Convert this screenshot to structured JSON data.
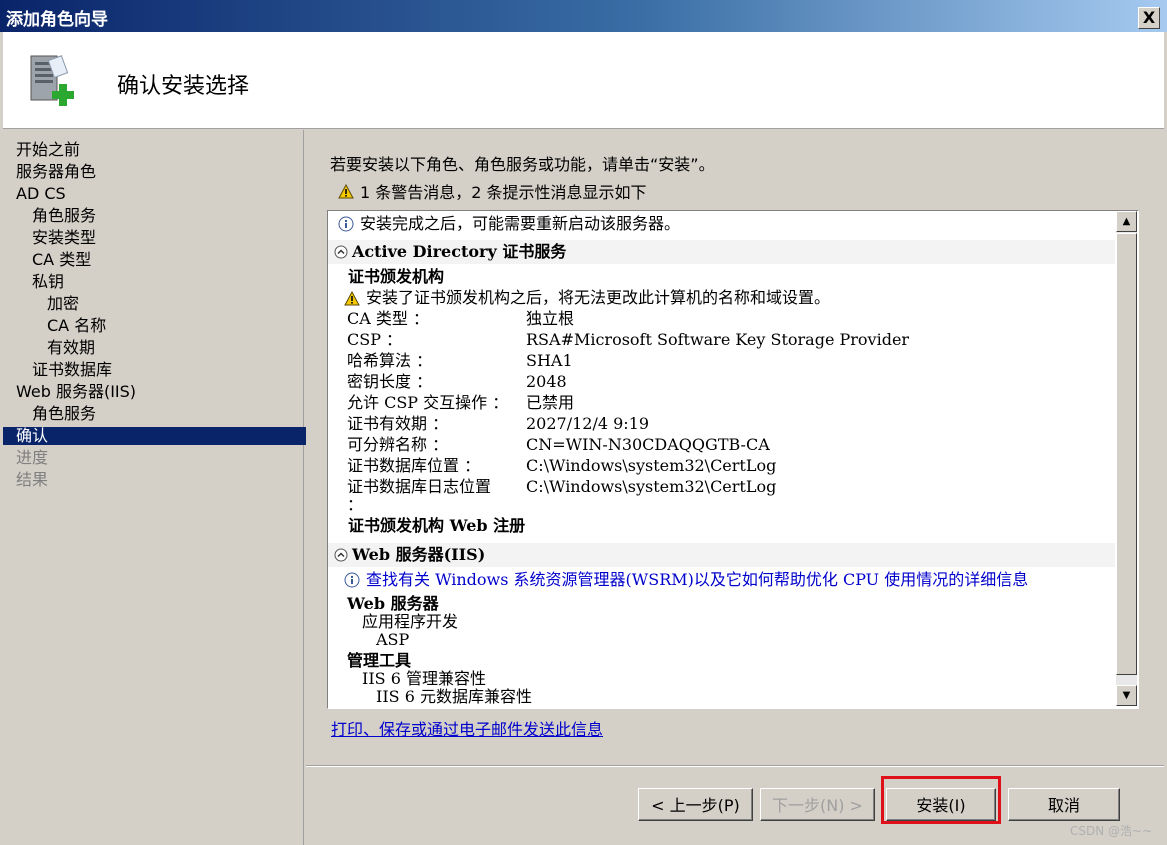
{
  "window": {
    "title": "添加角色向导",
    "close_glyph": "X"
  },
  "header": {
    "title": "确认安装选择",
    "icon": "server-add-icon"
  },
  "nav": {
    "items": [
      {
        "label": "开始之前",
        "state": "normal"
      },
      {
        "label": "服务器角色",
        "state": "normal"
      },
      {
        "label": "AD CS",
        "state": "normal"
      },
      {
        "label": "角色服务",
        "state": "normal"
      },
      {
        "label": "安装类型",
        "state": "normal"
      },
      {
        "label": "CA 类型",
        "state": "normal"
      },
      {
        "label": "私钥",
        "state": "normal"
      },
      {
        "label": "加密",
        "state": "normal"
      },
      {
        "label": "CA 名称",
        "state": "normal"
      },
      {
        "label": "有效期",
        "state": "normal"
      },
      {
        "label": "证书数据库",
        "state": "normal"
      },
      {
        "label": "Web 服务器(IIS)",
        "state": "normal"
      },
      {
        "label": "角色服务",
        "state": "normal"
      },
      {
        "label": "确认",
        "state": "active"
      },
      {
        "label": "进度",
        "state": "disabled"
      },
      {
        "label": "结果",
        "state": "disabled"
      }
    ]
  },
  "main": {
    "instruction": "若要安装以下角色、角色服务或功能，请单击“安装”。",
    "warning_summary": "1 条警告消息，2 条提示性消息显示如下",
    "details": {
      "info_restart": "安装完成之后，可能需要重新启动该服务器。",
      "adcs_section": "Active Directory 证书服务",
      "ca_heading": "证书颁发机构",
      "ca_warning": "安装了证书颁发机构之后，将无法更改此计算机的名称和域设置。",
      "props": [
        {
          "key": "CA 类型 ：",
          "value": "独立根"
        },
        {
          "key": "CSP ：",
          "value": "RSA#Microsoft Software Key Storage Provider"
        },
        {
          "key": "哈希算法 ：",
          "value": "SHA1"
        },
        {
          "key": "密钥长度 ：",
          "value": "2048"
        },
        {
          "key": "允许 CSP 交互操作 ：",
          "value": "已禁用"
        },
        {
          "key": "证书有效期 ：",
          "value": "2027/12/4 9:19"
        },
        {
          "key": "可分辨名称 ：",
          "value": "CN=WIN-N30CDAQQGTB-CA"
        },
        {
          "key": "证书数据库位置 ：",
          "value": "C:\\Windows\\system32\\CertLog"
        },
        {
          "key": "证书数据库日志位置",
          "value": "C:\\Windows\\system32\\CertLog"
        }
      ],
      "colon_wrap": "：",
      "web_enroll": "证书颁发机构 Web 注册",
      "iis_section": "Web 服务器(IIS)",
      "wsrm_link": "查找有关 Windows 系统资源管理器(WSRM)以及它如何帮助优化 CPU 使用情况的详细信息",
      "web_server": "Web 服务器",
      "app_dev": "应用程序开发",
      "asp": "ASP",
      "mgmt_tools": "管理工具",
      "iis6_compat": "IIS 6 管理兼容性",
      "iis6_meta": "IIS 6 元数据库兼容性"
    },
    "print_link": "打印、保存或通过电子邮件发送此信息"
  },
  "buttons": {
    "back": "< 上一步(P)",
    "next": "下一步(N) >",
    "install": "安装(I)",
    "cancel": "取消"
  },
  "watermark": "CSDN @浩~~",
  "colors": {
    "highlight": "#e0101a",
    "nav_active": "#0a246a",
    "link": "#0000cc"
  }
}
